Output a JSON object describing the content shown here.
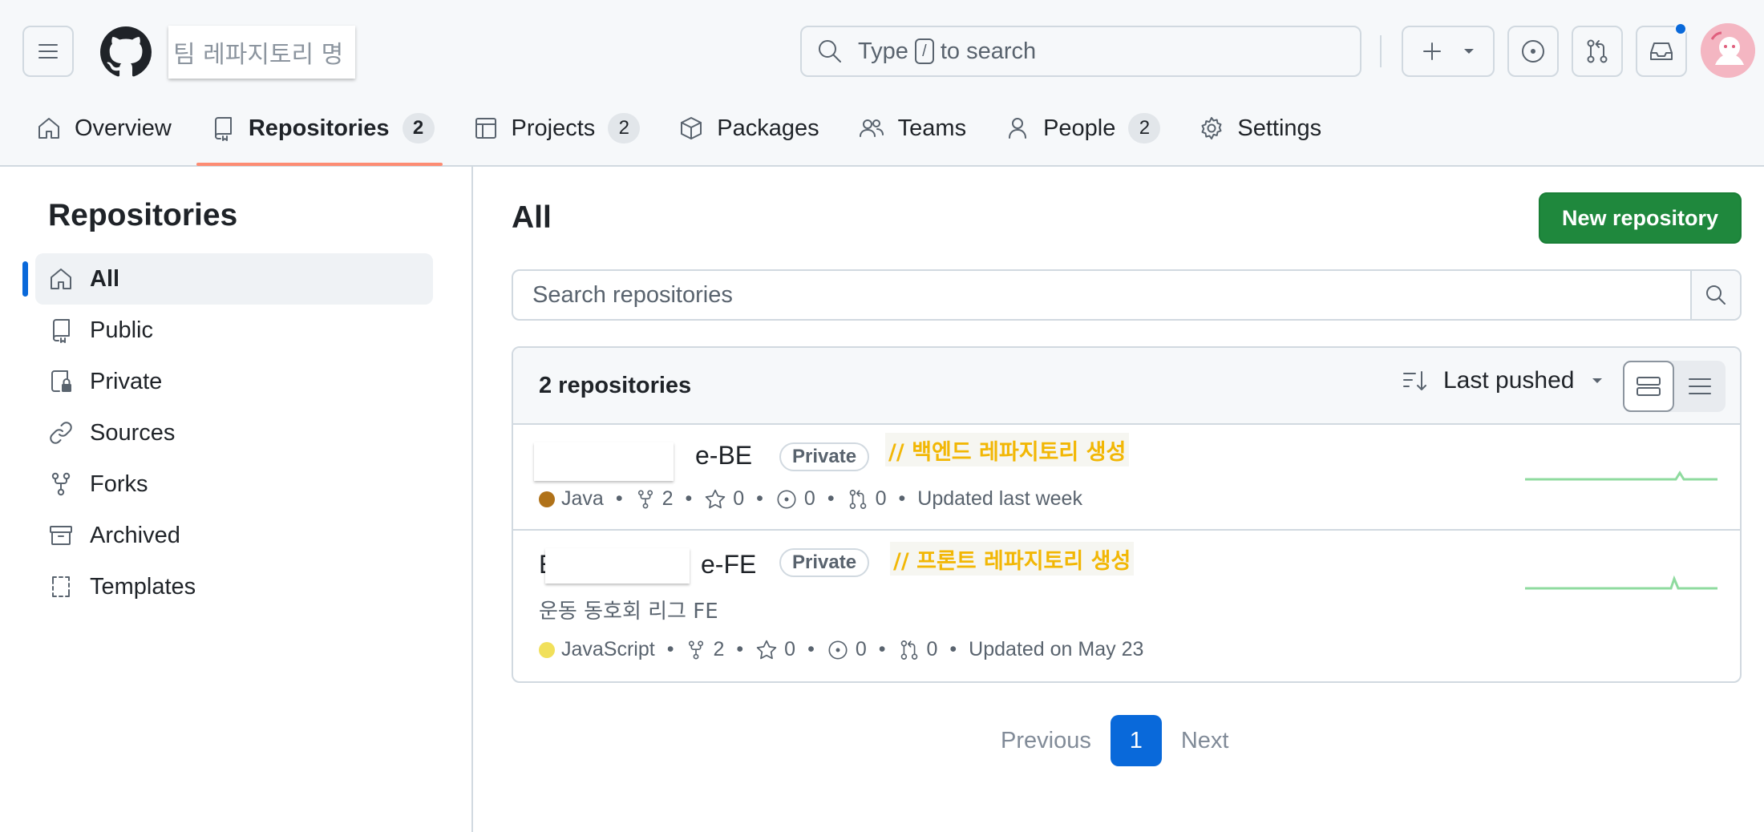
{
  "header": {
    "org_name": "팀 레파지토리 명",
    "search_prefix": "Type",
    "search_kbd": "/",
    "search_suffix": "to search"
  },
  "tabs": [
    {
      "label": "Overview",
      "icon": "home-icon"
    },
    {
      "label": "Repositories",
      "count": "2",
      "icon": "repo-icon",
      "active": true
    },
    {
      "label": "Projects",
      "count": "2",
      "icon": "table-icon"
    },
    {
      "label": "Packages",
      "icon": "package-icon"
    },
    {
      "label": "Teams",
      "icon": "people-icon"
    },
    {
      "label": "People",
      "count": "2",
      "icon": "person-icon"
    },
    {
      "label": "Settings",
      "icon": "gear-icon"
    }
  ],
  "sidebar": {
    "title": "Repositories",
    "items": [
      {
        "label": "All",
        "icon": "home-icon",
        "active": true
      },
      {
        "label": "Public",
        "icon": "repo-icon"
      },
      {
        "label": "Private",
        "icon": "lock-icon"
      },
      {
        "label": "Sources",
        "icon": "link-icon"
      },
      {
        "label": "Forks",
        "icon": "fork-icon"
      },
      {
        "label": "Archived",
        "icon": "archive-icon"
      },
      {
        "label": "Templates",
        "icon": "template-icon"
      }
    ]
  },
  "main": {
    "title": "All",
    "new_repo_label": "New repository",
    "search_placeholder": "Search repositories",
    "repo_count": "2 repositories",
    "sort_label": "Last pushed"
  },
  "repos": [
    {
      "name_visible": "e-BE",
      "visibility": "Private",
      "annotation": "// 백엔드 레파지토리 생성",
      "language": "Java",
      "language_color": "#b07219",
      "forks": "2",
      "stars": "0",
      "issues": "0",
      "pulls": "0",
      "updated": "Updated last week"
    },
    {
      "name_visible_start": "E",
      "name_visible": "e-FE",
      "visibility": "Private",
      "annotation": "// 프론트 레파지토리 생성",
      "description": "운동 동호회 리그 FE",
      "language": "JavaScript",
      "language_color": "#f1e05a",
      "forks": "2",
      "stars": "0",
      "issues": "0",
      "pulls": "0",
      "updated": "Updated on May 23"
    }
  ],
  "pagination": {
    "previous": "Previous",
    "current": "1",
    "next": "Next"
  },
  "colors": {
    "accent": "#0969da",
    "primary_button": "#1f883d",
    "tab_underline": "#fd8c73",
    "annotation_text": "#f2b705",
    "sparkline": "#8fdb9f"
  }
}
